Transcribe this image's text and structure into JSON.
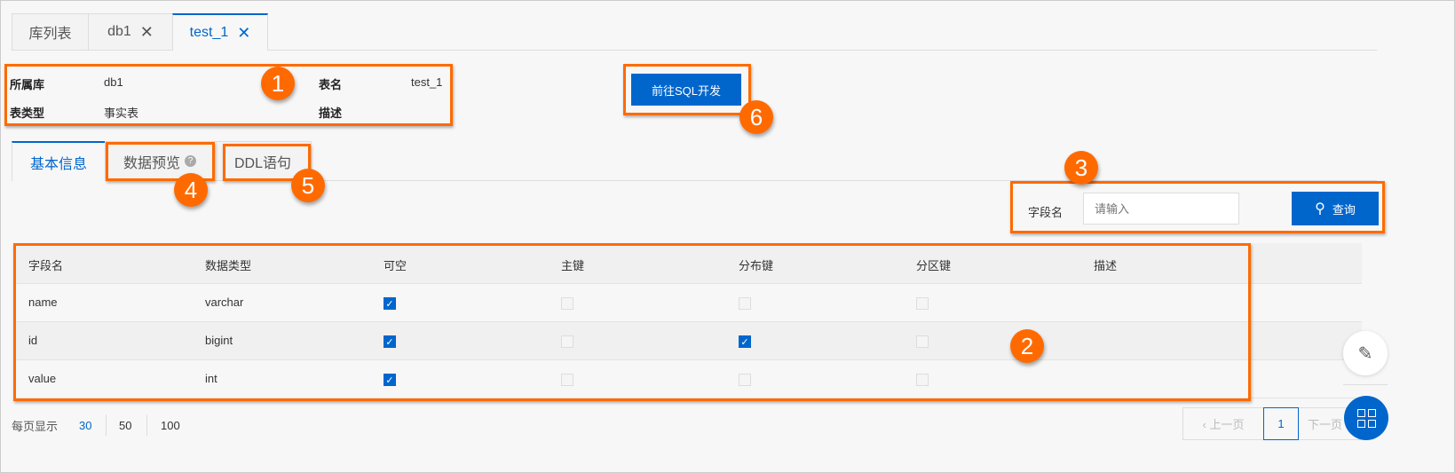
{
  "tabs": [
    {
      "label": "库列表"
    },
    {
      "label": "db1"
    },
    {
      "label": "test_1"
    }
  ],
  "info": {
    "db_label": "所属库",
    "db_value": "db1",
    "type_label": "表类型",
    "type_value": "事实表",
    "name_label": "表名",
    "name_value": "test_1",
    "desc_label": "描述",
    "desc_value": ""
  },
  "sql_button": "前往SQL开发",
  "subtabs": [
    {
      "label": "基本信息"
    },
    {
      "label": "数据预览"
    },
    {
      "label": "DDL语句"
    }
  ],
  "search": {
    "label": "字段名",
    "placeholder": "请输入",
    "button": "查询"
  },
  "table": {
    "headers": [
      "字段名",
      "数据类型",
      "可空",
      "主键",
      "分布键",
      "分区键",
      "描述"
    ],
    "rows": [
      {
        "name": "name",
        "type": "varchar",
        "nullable": true,
        "pk": false,
        "dist": false,
        "part": false
      },
      {
        "name": "id",
        "type": "bigint",
        "nullable": true,
        "pk": false,
        "dist": true,
        "part": false
      },
      {
        "name": "value",
        "type": "int",
        "nullable": true,
        "pk": false,
        "dist": false,
        "part": false
      }
    ]
  },
  "footer": {
    "per_page_label": "每页显示",
    "sizes": [
      "30",
      "50",
      "100"
    ],
    "selected": "30"
  },
  "pagination": {
    "prev": "上一页",
    "page": "1",
    "next": "下一页"
  },
  "badges": [
    "1",
    "2",
    "3",
    "4",
    "5",
    "6"
  ],
  "colors": {
    "accent": "#0066cc",
    "highlight": "#ff6a00"
  }
}
